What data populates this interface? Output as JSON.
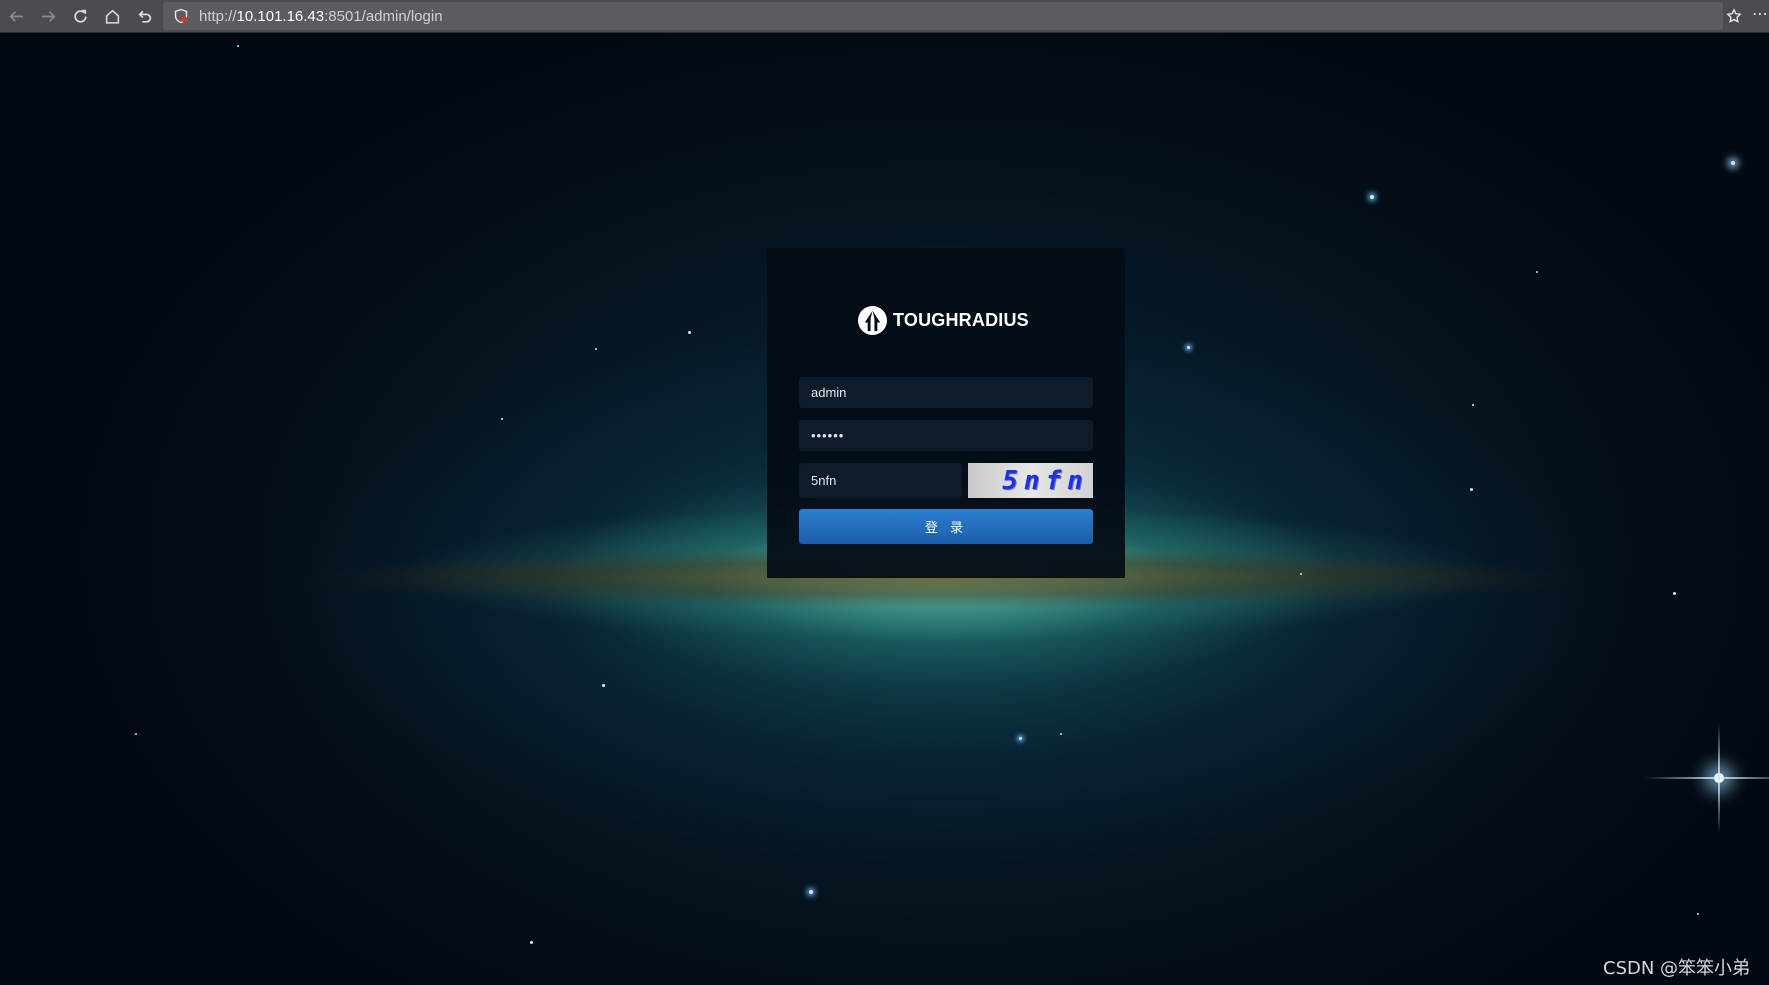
{
  "browser": {
    "url_prefix": "http://",
    "url_host": "10.101.16.43",
    "url_rest": ":8501/admin/login"
  },
  "login": {
    "logo_text": "TOUGHRADIUS",
    "username_value": "admin",
    "password_value": "••••••",
    "captcha_input_value": "5nfn",
    "captcha_image_text": "5nfn",
    "login_button_label": "登 录"
  },
  "watermark": "CSDN @笨笨小弟",
  "colors": {
    "button_blue": "#1f68b8",
    "panel_bg": "#040c16",
    "captcha_text": "#2230d6"
  }
}
